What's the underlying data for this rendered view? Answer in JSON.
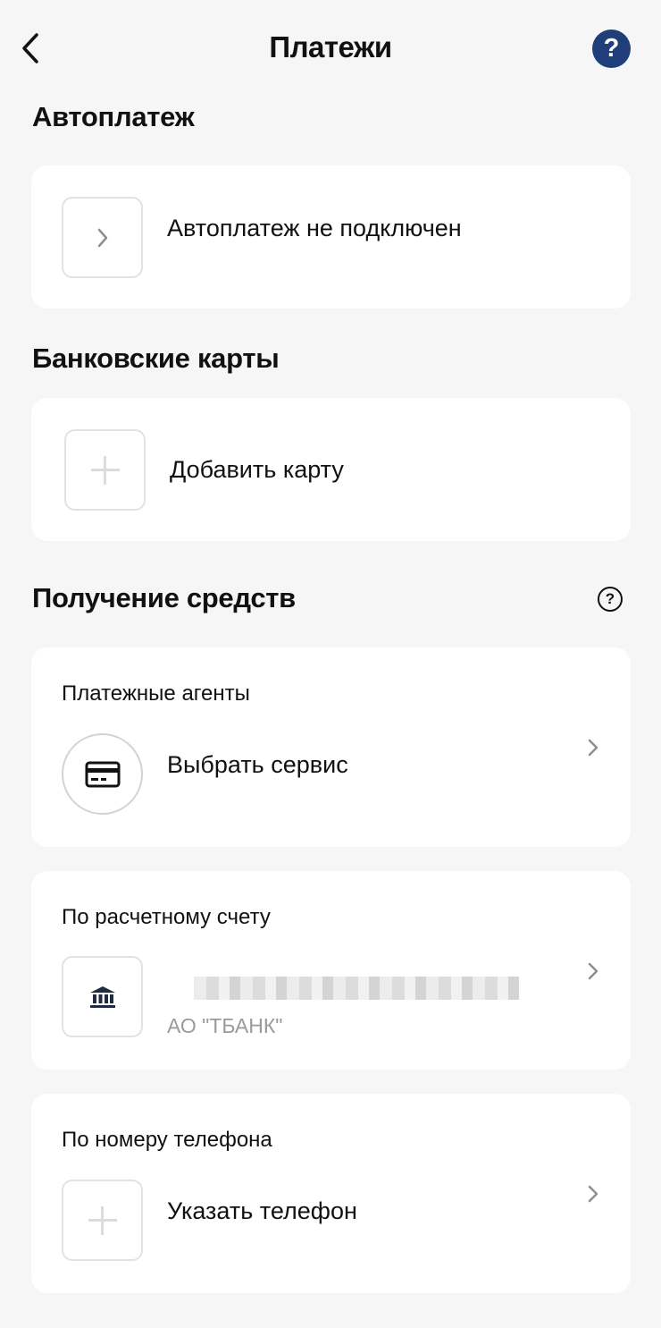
{
  "header": {
    "title": "Платежи",
    "back_icon": "chevron-left-icon",
    "help_icon": "question-circle-icon",
    "help_glyph": "?"
  },
  "autopay": {
    "section_title": "Автоплатеж",
    "status_text": "Автоплатеж не подключен",
    "icon": "chevron-right-icon"
  },
  "bank_cards": {
    "section_title": "Банковские карты",
    "add_card_label": "Добавить карту",
    "icon": "plus-icon"
  },
  "receiving": {
    "section_title": "Получение средств",
    "info_icon": "question-circle-outline-icon",
    "info_glyph": "?",
    "payment_agents": {
      "label": "Платежные агенты",
      "action": "Выбрать сервис",
      "icon": "credit-card-icon"
    },
    "settlement_account": {
      "label": "По расчетному счету",
      "bank_name": "АО \"ТБАНК\"",
      "icon": "bank-icon"
    },
    "phone": {
      "label": "По номеру телефона",
      "action": "Указать телефон",
      "icon": "plus-icon"
    }
  },
  "colors": {
    "background": "#f6f6f7",
    "card": "#ffffff",
    "accent": "#1f3e7a",
    "muted_text": "#9a9a9e"
  }
}
